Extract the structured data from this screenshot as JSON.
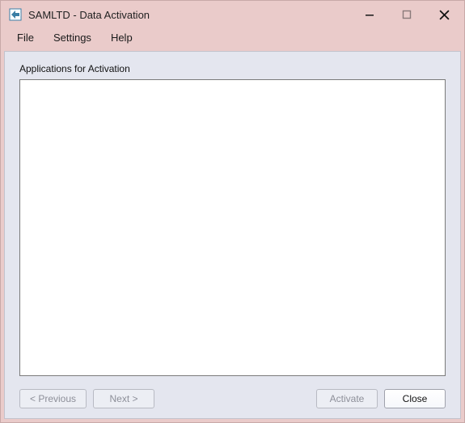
{
  "window": {
    "title": "SAMLTD - Data Activation"
  },
  "menu": {
    "file": "File",
    "settings": "Settings",
    "help": "Help"
  },
  "main": {
    "group_label": "Applications for Activation"
  },
  "buttons": {
    "previous": "< Previous",
    "next": "Next >",
    "activate": "Activate",
    "close": "Close"
  },
  "icons": {
    "app": "app-icon",
    "minimize": "minimize-icon",
    "maximize": "maximize-icon",
    "close_window": "close-icon"
  }
}
